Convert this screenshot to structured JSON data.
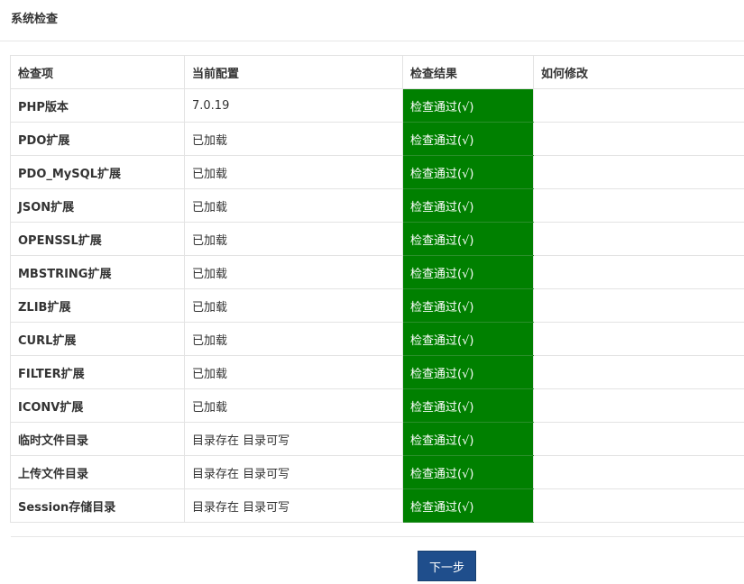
{
  "panel": {
    "title": "系统检查"
  },
  "table": {
    "headers": {
      "item": "检查项",
      "config": "当前配置",
      "result": "检查结果",
      "fix": "如何修改"
    },
    "rows": [
      {
        "item": "PHP版本",
        "config": "7.0.19",
        "result": "检查通过(√)",
        "fix": ""
      },
      {
        "item": "PDO扩展",
        "config": "已加载",
        "result": "检查通过(√)",
        "fix": ""
      },
      {
        "item": "PDO_MySQL扩展",
        "config": "已加载",
        "result": "检查通过(√)",
        "fix": ""
      },
      {
        "item": "JSON扩展",
        "config": "已加载",
        "result": "检查通过(√)",
        "fix": ""
      },
      {
        "item": "OPENSSL扩展",
        "config": "已加载",
        "result": "检查通过(√)",
        "fix": ""
      },
      {
        "item": "MBSTRING扩展",
        "config": "已加载",
        "result": "检查通过(√)",
        "fix": ""
      },
      {
        "item": "ZLIB扩展",
        "config": "已加载",
        "result": "检查通过(√)",
        "fix": ""
      },
      {
        "item": "CURL扩展",
        "config": "已加载",
        "result": "检查通过(√)",
        "fix": ""
      },
      {
        "item": "FILTER扩展",
        "config": "已加载",
        "result": "检查通过(√)",
        "fix": ""
      },
      {
        "item": "ICONV扩展",
        "config": "已加载",
        "result": "检查通过(√)",
        "fix": ""
      },
      {
        "item": "临时文件目录",
        "config": "目录存在 目录可写",
        "result": "检查通过(√)",
        "fix": ""
      },
      {
        "item": "上传文件目录",
        "config": "目录存在 目录可写",
        "result": "检查通过(√)",
        "fix": ""
      },
      {
        "item": "Session存储目录",
        "config": "目录存在 目录可写",
        "result": "检查通过(√)",
        "fix": ""
      }
    ]
  },
  "footer": {
    "next_label": "下一步"
  },
  "colors": {
    "pass_background": "#008000",
    "button_background": "#1f4e8c"
  }
}
